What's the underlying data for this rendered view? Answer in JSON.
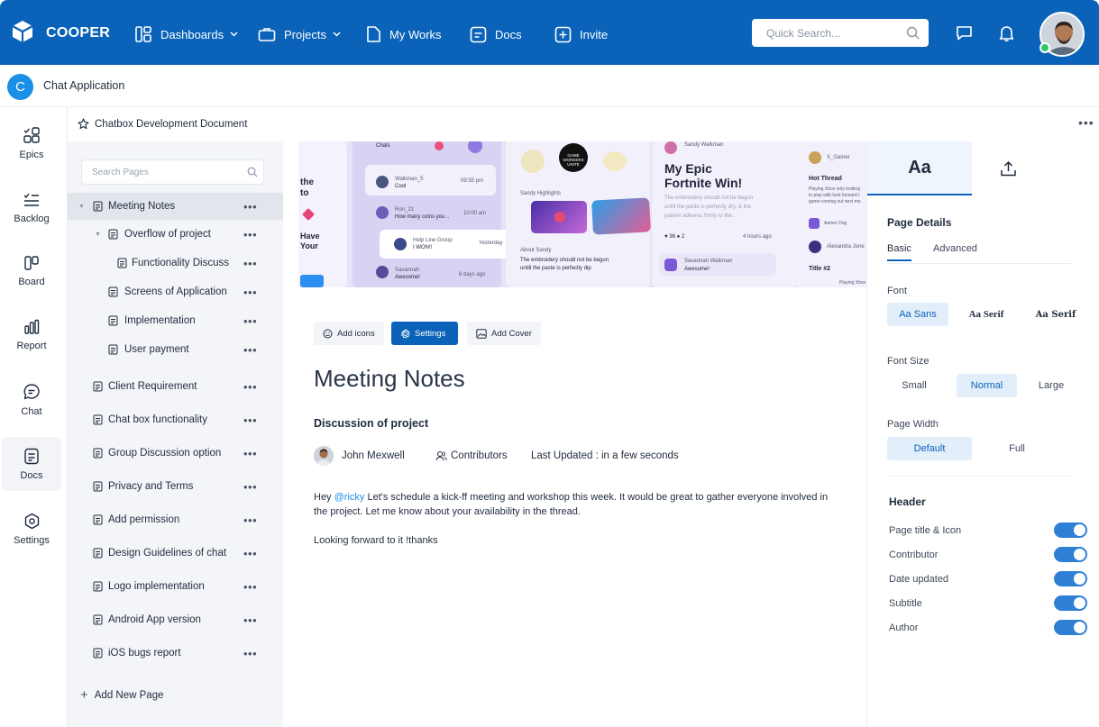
{
  "topbar": {
    "brand": "COOPER",
    "nav": [
      {
        "label": "Dashboards",
        "icon": "grid-icon",
        "has_dropdown": true
      },
      {
        "label": "Projects",
        "icon": "briefcase-icon",
        "has_dropdown": true
      },
      {
        "label": "My Works",
        "icon": "file-icon",
        "has_dropdown": false
      },
      {
        "label": "Docs",
        "icon": "doc-icon",
        "has_dropdown": false
      },
      {
        "label": "Invite",
        "icon": "plus-square-icon",
        "has_dropdown": false
      }
    ],
    "search_placeholder": "Quick Search...",
    "accent": "#0a63b8"
  },
  "app": {
    "initial": "C",
    "title": "Chat Application"
  },
  "rail": [
    {
      "label": "Epics",
      "icon": "epics-icon",
      "active": false
    },
    {
      "label": "Backlog",
      "icon": "backlog-icon",
      "active": false
    },
    {
      "label": "Board",
      "icon": "board-icon",
      "active": false
    },
    {
      "label": "Report",
      "icon": "report-icon",
      "active": false
    },
    {
      "label": "Chat",
      "icon": "chat-icon",
      "active": false
    },
    {
      "label": "Docs",
      "icon": "docs-icon",
      "active": true
    },
    {
      "label": "Settings",
      "icon": "settings-icon",
      "active": false
    }
  ],
  "document": {
    "title": "Chatbox Development Document"
  },
  "pages": {
    "search_placeholder": "Search Pages",
    "items": [
      {
        "label": "Meeting Notes",
        "level": 0,
        "expanded": true,
        "selected": true
      },
      {
        "label": "Overflow of project",
        "level": 1,
        "expanded": true,
        "selected": false
      },
      {
        "label": "Functionality Discuss",
        "level": 2,
        "expanded": false,
        "selected": false
      },
      {
        "label": "Screens of Application",
        "level": 1,
        "expanded": false,
        "selected": false
      },
      {
        "label": "Implementation",
        "level": 1,
        "expanded": false,
        "selected": false
      },
      {
        "label": "User payment",
        "level": 1,
        "expanded": false,
        "selected": false
      },
      {
        "label": "Client Requirement",
        "level": 0,
        "expanded": false,
        "selected": false
      },
      {
        "label": "Chat box functionality",
        "level": 0,
        "expanded": false,
        "selected": false
      },
      {
        "label": "Group Discussion option",
        "level": 0,
        "expanded": false,
        "selected": false
      },
      {
        "label": "Privacy and Terms",
        "level": 0,
        "expanded": false,
        "selected": false
      },
      {
        "label": "Add permission",
        "level": 0,
        "expanded": false,
        "selected": false
      },
      {
        "label": "Design Guidelines of chat",
        "level": 0,
        "expanded": false,
        "selected": false
      },
      {
        "label": "Logo  implementation",
        "level": 0,
        "expanded": false,
        "selected": false
      },
      {
        "label": "Android App version",
        "level": 0,
        "expanded": false,
        "selected": false
      },
      {
        "label": "iOS bugs report",
        "level": 0,
        "expanded": false,
        "selected": false
      }
    ],
    "add_label": "Add New Page"
  },
  "cover": {
    "chats_label": "Chats",
    "msgs": [
      {
        "name": "Walkman_5",
        "text": "Cool",
        "time": "09:55 pm"
      },
      {
        "name": "Ron_21",
        "text": "How many coins you ..",
        "time": "10:00 am"
      },
      {
        "name": "Help Line Group",
        "text": "I WON!!",
        "time": "Yesterday"
      },
      {
        "name": "Savannah",
        "text": "Awesome!",
        "time": "6 days ago"
      }
    ],
    "left_partial": [
      "the",
      "to",
      "Have",
      "Your"
    ],
    "sandy_highlights": "Sandy Highlights",
    "about_sandy": "About Sandy",
    "about_text_1": "The embroidery should not be begun",
    "about_text_2": "untill the paste is perfectly dip",
    "game_badge": "GAME WORKERS UNITE",
    "post_author": "Sandy Walkman",
    "post_title_1": "My Epic",
    "post_title_2": "Fortnite Win!",
    "post_body_1": "The embroidery should not be begun",
    "post_body_2": "untill the paste is perfectly dry, & the",
    "post_body_3": "pattern adheres firmly to the..",
    "post_stats": "36",
    "post_comments": "2",
    "post_time": "4 hours ago",
    "comment_author": "Savannah Walkman",
    "comment_text": "Awesome!",
    "right_user": "X_Gamer",
    "hot_thread": "Hot Thread",
    "hot_text_1": "Playing Xbox only looking",
    "hot_text_2": "to play with look forward t",
    "hot_text_3": "game coming out next mo",
    "right_user2": "Aamer Dog",
    "right_user3": "Alexandra Jone",
    "title2": "Title #2",
    "playing": "Playing Xbox"
  },
  "toolbar": {
    "add_icons": "Add icons",
    "settings": "Settings",
    "add_cover": "Add Cover"
  },
  "content": {
    "title": "Meeting Notes",
    "subtitle": "Discussion of  project",
    "author": "John Mexwell",
    "contributors": "Contributors",
    "last_updated": "Last Updated : in a few seconds",
    "para1_pre": "Hey ",
    "mention": "@ricky",
    "para1_post": " Let's schedule a kick-ff meeting and workshop this week. It would be great to gather everyone involved in the project. Let me know about your availability in the thread.",
    "para2": "Looking forward to it !thanks"
  },
  "panel": {
    "tab_text": "Aa",
    "section": "Page Details",
    "subtabs": [
      "Basic",
      "Advanced"
    ],
    "font_label": "Font",
    "fonts": [
      "Aa Sans",
      "Aa Serif",
      "Aa Serif"
    ],
    "size_label": "Font Size",
    "sizes": [
      "Small",
      "Normal",
      "Large"
    ],
    "width_label": "Page Width",
    "widths": [
      "Default",
      "Full"
    ],
    "header_label": "Header",
    "toggles": [
      {
        "label": "Page title & Icon",
        "on": true
      },
      {
        "label": "Contributor",
        "on": true
      },
      {
        "label": "Date updated",
        "on": true
      },
      {
        "label": "Subtitle",
        "on": true
      },
      {
        "label": "Author",
        "on": true
      }
    ]
  }
}
